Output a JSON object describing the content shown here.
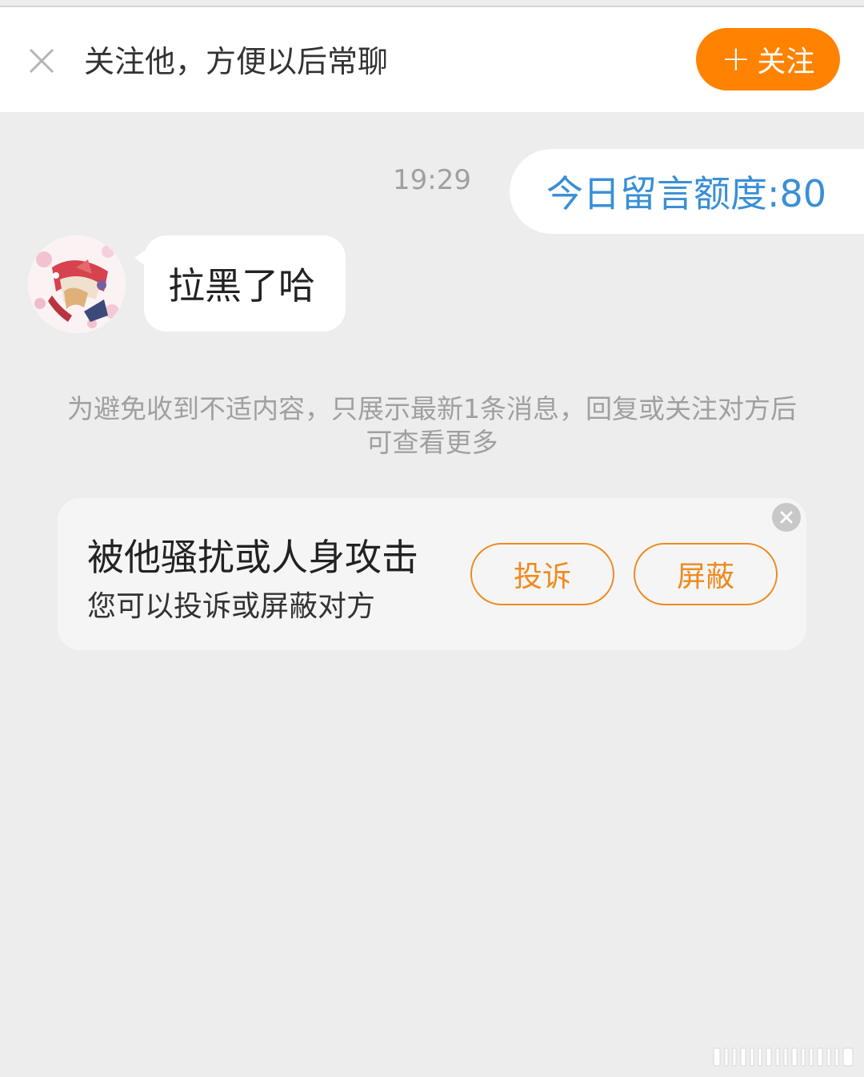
{
  "header": {
    "title": "关注他，方便以后常聊",
    "follow_label": "关注",
    "close_icon": "close-icon",
    "accent_color": "#ff8200"
  },
  "conversation": {
    "timestamp": "19:29",
    "outgoing_message": "今日留言额度:80",
    "incoming_message": "拉黑了哈",
    "outgoing_color": "#3a8fd6"
  },
  "notice": {
    "text": "为避免收到不适内容，只展示最新1条消息，回复或关注对方后可查看更多"
  },
  "report_card": {
    "title": "被他骚扰或人身攻击",
    "subtitle": "您可以投诉或屏蔽对方",
    "report_label": "投诉",
    "block_label": "屏蔽",
    "dismiss_icon": "close-circle-icon"
  }
}
